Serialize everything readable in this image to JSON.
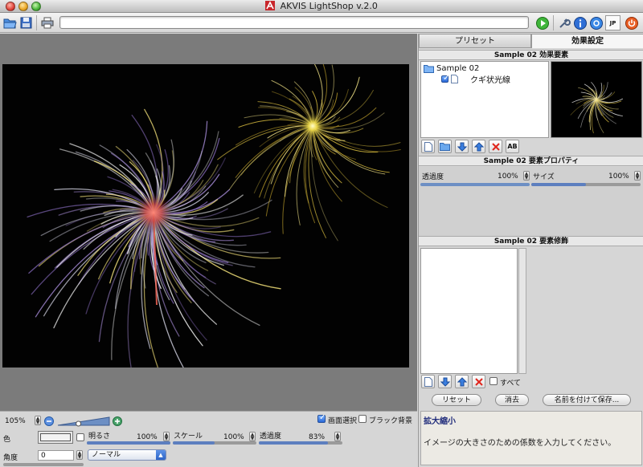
{
  "window": {
    "title": "AKVIS LightShop v.2.0"
  },
  "toolbar": {
    "path_value": ""
  },
  "bottom": {
    "zoom_value": "105%",
    "select_screen_label": "画面選択",
    "black_bg_label": "ブラック背景",
    "color_label": "色",
    "brightness_label": "明るさ",
    "brightness_value": "100%",
    "scale_label": "スケール",
    "scale_value": "100%",
    "opacity_label": "透過度",
    "opacity_value": "83%",
    "angle_label": "角度",
    "angle_value": "0",
    "mode_value": "ノーマル",
    "brightness_level": 1.0,
    "scale_level": 0.5,
    "opacity_level": 0.83,
    "zoom_level": 0.4
  },
  "right": {
    "tabs": [
      {
        "label": "プリセット"
      },
      {
        "label": "効果設定"
      }
    ],
    "elements_header": "Sample 02 効果要素",
    "tree_root": "Sample 02",
    "tree_child": "クギ状光線",
    "props_header": "Sample 02 要素プロパティ",
    "prop_opacity_label": "透過度",
    "prop_opacity_value": "100%",
    "prop_size_label": "サイズ",
    "prop_size_value": "100%",
    "modifiers_header": "Sample 02 要素修飾",
    "all_label": "すべて",
    "reset_label": "リセット",
    "delete_label": "消去",
    "save_as_label": "名前を付けて保存...",
    "help_title": "拡大縮小",
    "help_text": "イメージの大きさのための係数を入力してください。"
  },
  "colors": {
    "accent": "#2a68d8",
    "slider": "#5d7fbf"
  }
}
